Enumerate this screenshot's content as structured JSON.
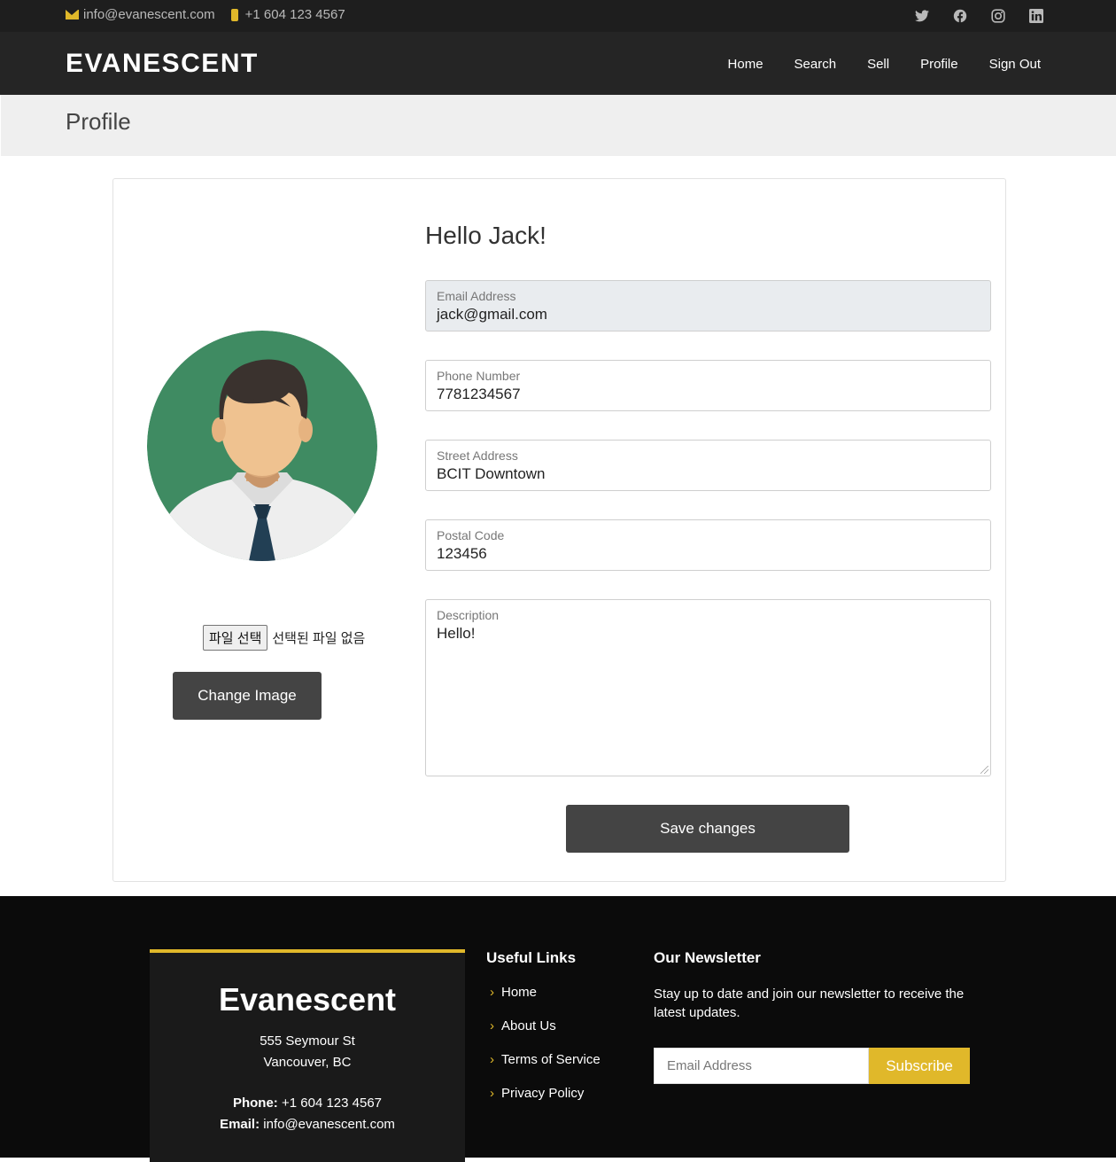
{
  "topbar": {
    "email": "info@evanescent.com",
    "phone": "+1 604 123 4567",
    "social": [
      "twitter-icon",
      "facebook-icon",
      "instagram-icon",
      "linkedin-icon"
    ]
  },
  "header": {
    "logo": "EVANESCENT",
    "nav": [
      "Home",
      "Search",
      "Sell",
      "Profile",
      "Sign Out"
    ]
  },
  "page_title": "Profile",
  "profile": {
    "greeting": "Hello Jack!",
    "file_button": "파일 선택",
    "file_status": "선택된 파일 없음",
    "change_image": "Change Image",
    "fields": [
      {
        "label": "Email Address",
        "value": "jack@gmail.com"
      },
      {
        "label": "Phone Number",
        "value": "7781234567"
      },
      {
        "label": "Street Address",
        "value": "BCIT Downtown"
      },
      {
        "label": "Postal Code",
        "value": "123456"
      },
      {
        "label": "Description",
        "value": "Hello!"
      }
    ],
    "save": "Save changes"
  },
  "footer": {
    "brand": "Evanescent",
    "address1": "555 Seymour St",
    "address2": "Vancouver, BC",
    "phone_label": "Phone:",
    "phone": "+1 604 123 4567",
    "email_label": "Email:",
    "email": "info@evanescent.com",
    "links_title": "Useful Links",
    "links": [
      "Home",
      "About Us",
      "Terms of Service",
      "Privacy Policy"
    ],
    "news_title": "Our Newsletter",
    "news_text": "Stay up to date and join our newsletter to receive the latest updates.",
    "news_placeholder": "Email Address",
    "subscribe": "Subscribe"
  },
  "colors": {
    "accent": "#e0b82a",
    "dark": "#252525",
    "button": "#444444"
  }
}
